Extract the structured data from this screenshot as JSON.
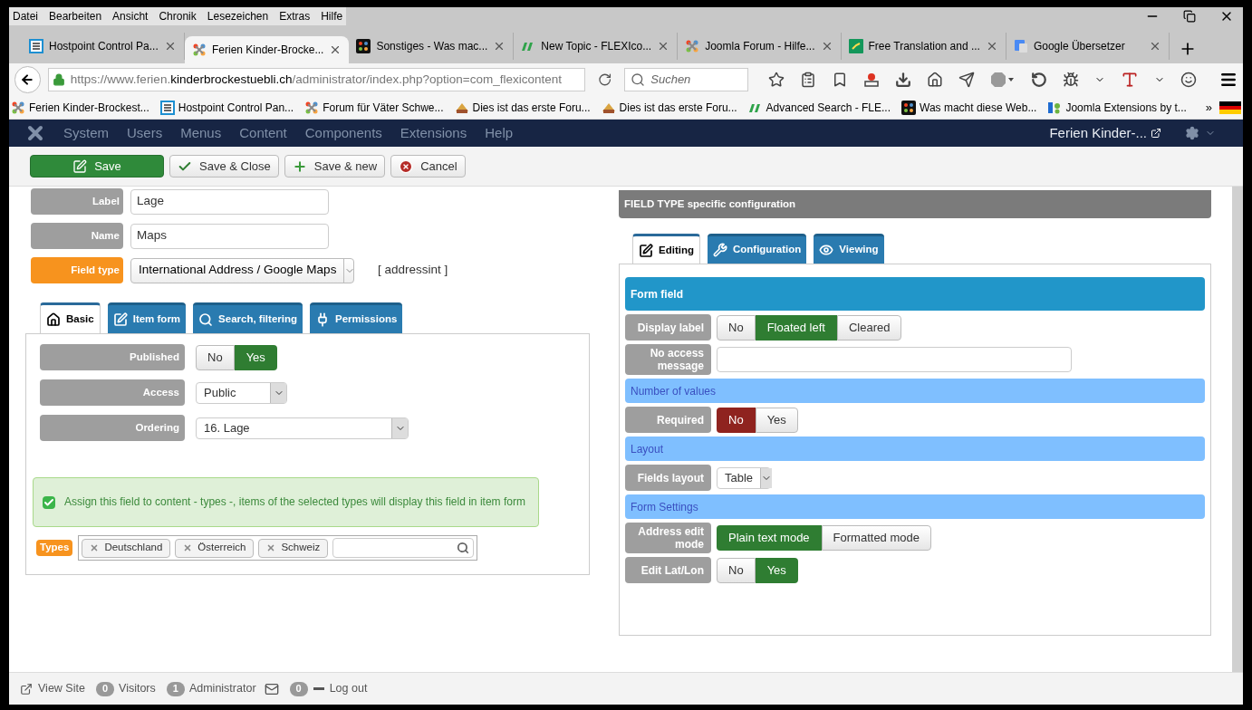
{
  "menu_bar": [
    "Datei",
    "Bearbeiten",
    "Ansicht",
    "Chronik",
    "Lesezeichen",
    "Extras",
    "Hilfe"
  ],
  "tabs": [
    {
      "title": "Hostpoint Control Pa...",
      "kind": "document",
      "selected": false
    },
    {
      "title": "Ferien Kinder-Brocke...",
      "kind": "joomla",
      "selected": true
    },
    {
      "title": "Sonstiges - Was mac...",
      "kind": "joomla-dark",
      "selected": false
    },
    {
      "title": "New Topic - FLEXIco...",
      "kind": "flexi",
      "selected": false
    },
    {
      "title": "Joomla Forum - Hilfe...",
      "kind": "joomla",
      "selected": false
    },
    {
      "title": "Free Translation and ...",
      "kind": "translate",
      "selected": false
    },
    {
      "title": "Google Übersetzer",
      "kind": "google",
      "selected": false
    }
  ],
  "address": {
    "prefix": "https://www.ferien.",
    "domain": "kinderbrockestuebli.ch",
    "rest": "/administrator/index.php?option=com_flexicontent"
  },
  "search": {
    "placeholder": "Suchen"
  },
  "bookmarks": [
    {
      "title": "Ferien Kinder-Brockest...",
      "kind": "joomla"
    },
    {
      "title": "Hostpoint Control Pan...",
      "kind": "document"
    },
    {
      "title": "Forum für Väter Schwe...",
      "kind": "joomla"
    },
    {
      "title": "Dies ist das erste Foru...",
      "kind": "flexi-logo"
    },
    {
      "title": "Dies ist das erste Foru...",
      "kind": "flexi-logo"
    },
    {
      "title": "Advanced Search - FLE...",
      "kind": "flexi"
    },
    {
      "title": "Was macht diese Web...",
      "kind": "joomla-dark"
    },
    {
      "title": "Joomla Extensions by t...",
      "kind": "extensions"
    }
  ],
  "bookmarks_more": "»",
  "admin_nav": {
    "items": [
      "System",
      "Users",
      "Menus",
      "Content",
      "Components",
      "Extensions",
      "Help"
    ],
    "site": "Ferien Kinder-..."
  },
  "toolbar": [
    {
      "label": "Save",
      "kind": "save"
    },
    {
      "label": "Save & Close",
      "kind": "save-close"
    },
    {
      "label": "Save & new",
      "kind": "save-new"
    },
    {
      "label": "Cancel",
      "kind": "cancel"
    }
  ],
  "fields": [
    {
      "label": "Label",
      "value": "Lage",
      "kind": "input",
      "highlighted": false
    },
    {
      "label": "Name",
      "value": "Maps",
      "kind": "input",
      "highlighted": false
    },
    {
      "label": "Field type",
      "value": "International Address / Google Maps",
      "kind": "select",
      "highlighted": true,
      "code": "[ addressint ]"
    }
  ],
  "left_tabs": [
    {
      "label": "Basic",
      "kind": "home",
      "selected": true
    },
    {
      "label": "Item form",
      "kind": "edit",
      "selected": false
    },
    {
      "label": "Search, filtering",
      "kind": "search",
      "selected": false
    },
    {
      "label": "Permissions",
      "kind": "plug",
      "selected": false
    }
  ],
  "basic_rows": [
    {
      "label": "Published",
      "kind": "toggle",
      "options": [
        {
          "label": "No",
          "selected": false
        },
        {
          "label": "Yes",
          "selected": true,
          "color": "#2f7d32"
        }
      ]
    },
    {
      "label": "Access",
      "kind": "select",
      "value": "Public"
    },
    {
      "label": "Ordering",
      "kind": "select",
      "value": "16. Lage"
    }
  ],
  "notice": {
    "text": "Assign this field to content - types -, items of the selected types will display this field in item form",
    "checked": true
  },
  "types": {
    "label": "Types",
    "tags": [
      "Deutschland",
      "Österreich",
      "Schweiz"
    ]
  },
  "config": {
    "title": "FIELD TYPE specific configuration",
    "tabs": [
      {
        "label": "Editing",
        "kind": "edit",
        "selected": true
      },
      {
        "label": "Configuration",
        "kind": "wrench",
        "selected": false
      },
      {
        "label": "Viewing",
        "kind": "eye",
        "selected": false
      }
    ],
    "rows": [
      {
        "kind": "header",
        "label": "Form field"
      },
      {
        "kind": "toggle",
        "label": "Display label",
        "options": [
          {
            "label": "No",
            "selected": false
          },
          {
            "label": "Floated left",
            "selected": true,
            "color": "#2f7d32"
          },
          {
            "label": "Cleared",
            "selected": false
          }
        ]
      },
      {
        "kind": "input",
        "label": "No access message"
      },
      {
        "kind": "subheader",
        "label": "Number of values"
      },
      {
        "kind": "toggle",
        "label": "Required",
        "options": [
          {
            "label": "No",
            "selected": true,
            "color": "#8f231f"
          },
          {
            "label": "Yes",
            "selected": false
          }
        ]
      },
      {
        "kind": "subheader",
        "label": "Layout"
      },
      {
        "kind": "select",
        "label": "Fields layout",
        "value": "Table"
      },
      {
        "kind": "subheader",
        "label": "Form Settings"
      },
      {
        "kind": "toggle",
        "label": "Address edit mode",
        "options": [
          {
            "label": "Plain text mode",
            "selected": true,
            "color": "#2f7d32"
          },
          {
            "label": "Formatted mode",
            "selected": false
          }
        ]
      },
      {
        "kind": "toggle",
        "label": "Edit Lat/Lon",
        "options": [
          {
            "label": "No",
            "selected": false
          },
          {
            "label": "Yes",
            "selected": true,
            "color": "#2f7d32"
          }
        ]
      }
    ]
  },
  "status_bar": [
    {
      "kind": "link",
      "label": "View Site"
    },
    {
      "kind": "count",
      "count": "0",
      "label": "Visitors"
    },
    {
      "kind": "count",
      "count": "1",
      "label": "Administrator"
    },
    {
      "kind": "logout",
      "count": "0",
      "label": "Log out"
    }
  ]
}
